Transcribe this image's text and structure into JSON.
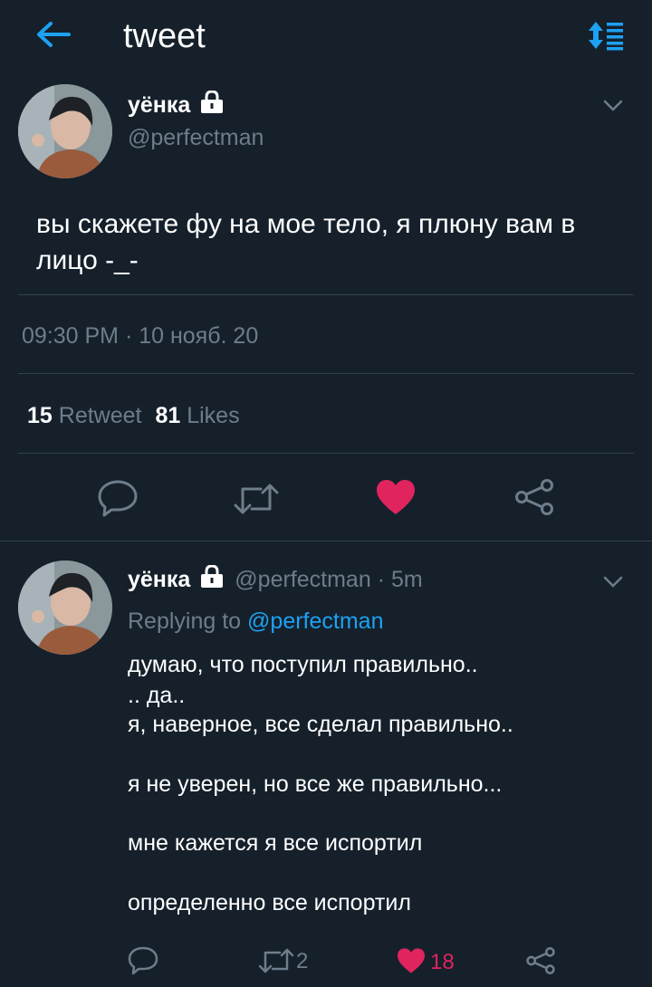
{
  "header": {
    "title": "tweet",
    "back_icon": "arrow-left-icon",
    "sort_icon": "sort-icon"
  },
  "colors": {
    "background": "#15202b",
    "accent": "#1da1f2",
    "muted": "#6e7d8b",
    "like": "#e0245e",
    "separator": "#33414f"
  },
  "main_tweet": {
    "name": "уёнка",
    "handle": "@perfectman",
    "text_line1": "вы скажете фу на мое тело, я плюну вам в",
    "text_line2": "лицо -_-",
    "timestamp": "09:30 PM · 10 нояб. 20",
    "retweet_count": "15",
    "retweet_label": "Retweet",
    "like_count": "81",
    "like_label": "Likes"
  },
  "reply": {
    "name": "уёнка",
    "handle": "@perfectman",
    "time": "· 5m",
    "replying_prefix": "Replying to",
    "replying_to": "@perfectman",
    "lines": [
      "думаю, что поступил правильно..",
      ".. да..",
      "я, наверное, все сделал правильно..",
      "я не уверен, но все же правильно...",
      "мне кажется я все испортил",
      "определенно все испортил"
    ],
    "retweet_count": "2",
    "like_count": "18"
  }
}
